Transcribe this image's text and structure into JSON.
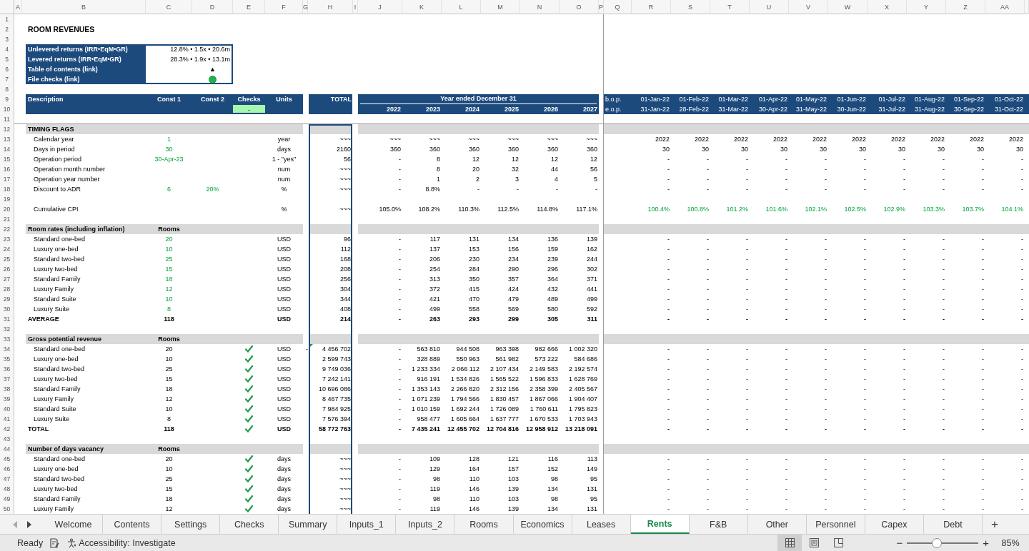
{
  "title": "ROOM REVENUES",
  "column_headers": [
    "A",
    "B",
    "C",
    "D",
    "E",
    "F",
    "G",
    "H",
    "I",
    "J",
    "K",
    "L",
    "M",
    "N",
    "O",
    "P",
    "Q",
    "R",
    "S",
    "T",
    "U",
    "V",
    "W",
    "X",
    "Y",
    "Z",
    "AA"
  ],
  "row_numbers": [
    "1",
    "2",
    "3",
    "4",
    "5",
    "6",
    "7",
    "8",
    "9",
    "10",
    "11",
    "12",
    "13",
    "14",
    "15",
    "16",
    "17",
    "18",
    "19",
    "20",
    "21",
    "22",
    "23",
    "24",
    "25",
    "26",
    "27",
    "28",
    "29",
    "30",
    "31",
    "32",
    "33",
    "34",
    "35",
    "36",
    "37",
    "38",
    "39",
    "40",
    "41",
    "42",
    "43",
    "44",
    "45",
    "46",
    "47",
    "48",
    "49",
    "50"
  ],
  "summary": [
    {
      "label": "Unlevered returns (IRR•EqM•GR)",
      "kind": "text",
      "value": "12.8% • 1.5x • 20.6m"
    },
    {
      "label": "Levered returns (IRR•EqM•GR)",
      "kind": "text",
      "value": "28.3% • 1.9x • 13.1m"
    },
    {
      "label": "Table of contents (link)",
      "kind": "link",
      "value": "▲"
    },
    {
      "label": "File checks (link)",
      "kind": "status",
      "ok": true
    }
  ],
  "header": {
    "description": "Description",
    "const1": "Const 1",
    "const2": "Const 2",
    "checks": "Checks",
    "checks_value": "-",
    "units": "Units",
    "total": "TOTAL",
    "annual_title": "Year ended December 31",
    "years": [
      "2022",
      "2023",
      "2024",
      "2025",
      "2026",
      "2027"
    ],
    "bop_label": "b.o.p.",
    "eop_label": "e.o.p.",
    "bop": [
      "01-Jan-22",
      "01-Feb-22",
      "01-Mar-22",
      "01-Apr-22",
      "01-May-22",
      "01-Jun-22",
      "01-Jul-22",
      "01-Aug-22",
      "01-Sep-22",
      "01-Oct-22"
    ],
    "eop": [
      "31-Jan-22",
      "28-Feb-22",
      "31-Mar-22",
      "30-Apr-22",
      "31-May-22",
      "30-Jun-22",
      "31-Jul-22",
      "31-Aug-22",
      "30-Sep-22",
      "31-Oct-22"
    ]
  },
  "rows": [
    {
      "kind": "section",
      "label": "TIMING FLAGS"
    },
    {
      "kind": "item",
      "label": "Calendar year",
      "const1": "1",
      "input": true,
      "units": "year",
      "total": "~~~",
      "annual": [
        "~~~",
        "~~~",
        "~~~",
        "~~~",
        "~~~",
        "~~~"
      ],
      "monthly": [
        "2022",
        "2022",
        "2022",
        "2022",
        "2022",
        "2022",
        "2022",
        "2022",
        "2022",
        "2022"
      ]
    },
    {
      "kind": "item",
      "label": "Days in period",
      "const1": "30",
      "input": true,
      "units": "days",
      "total": "2160",
      "annual": [
        "360",
        "360",
        "360",
        "360",
        "360",
        "360"
      ],
      "monthly": [
        "30",
        "30",
        "30",
        "30",
        "30",
        "30",
        "30",
        "30",
        "30",
        "30"
      ]
    },
    {
      "kind": "item",
      "label": "Operation period",
      "const1": "30-Apr-23",
      "input": true,
      "units": "1 - \"yes\"",
      "total": "56",
      "annual": [
        "-",
        "8",
        "12",
        "12",
        "12",
        "12"
      ],
      "monthly": [
        "-",
        "-",
        "-",
        "-",
        "-",
        "-",
        "-",
        "-",
        "-",
        "-"
      ]
    },
    {
      "kind": "item",
      "label": "Operation month number",
      "units": "num",
      "total": "~~~",
      "annual": [
        "-",
        "8",
        "20",
        "32",
        "44",
        "56"
      ],
      "monthly": [
        "-",
        "-",
        "-",
        "-",
        "-",
        "-",
        "-",
        "-",
        "-",
        "-"
      ]
    },
    {
      "kind": "item",
      "label": "Operation year number",
      "units": "num",
      "total": "~~~",
      "annual": [
        "-",
        "1",
        "2",
        "3",
        "4",
        "5"
      ],
      "monthly": [
        "-",
        "-",
        "-",
        "-",
        "-",
        "-",
        "-",
        "-",
        "-",
        "-"
      ]
    },
    {
      "kind": "item",
      "label": "Discount to ADR",
      "const1": "6",
      "const2": "20%",
      "input": true,
      "units": "%",
      "total": "~~~",
      "annual": [
        "-",
        "8.8%",
        "-",
        "-",
        "-",
        "-"
      ],
      "monthly": [
        "-",
        "-",
        "-",
        "-",
        "-",
        "-",
        "-",
        "-",
        "-",
        "-"
      ]
    },
    {
      "kind": "blank"
    },
    {
      "kind": "item",
      "label": "Cumulative CPI",
      "units": "%",
      "total": "~~~",
      "annual": [
        "105.0%",
        "108.2%",
        "110.3%",
        "112.5%",
        "114.8%",
        "117.1%"
      ],
      "monthly_input": true,
      "monthly": [
        "100.4%",
        "100.8%",
        "101.2%",
        "101.6%",
        "102.1%",
        "102.5%",
        "102.9%",
        "103.3%",
        "103.7%",
        "104.1%"
      ]
    },
    {
      "kind": "blank"
    },
    {
      "kind": "section",
      "label": "Room rates (including inflation)",
      "const1": "Rooms"
    },
    {
      "kind": "item",
      "label": "Standard one-bed",
      "const1": "20",
      "input": true,
      "units": "USD",
      "total": "96",
      "annual": [
        "-",
        "117",
        "131",
        "134",
        "136",
        "139"
      ],
      "monthly": [
        "-",
        "-",
        "-",
        "-",
        "-",
        "-",
        "-",
        "-",
        "-",
        "-"
      ]
    },
    {
      "kind": "item",
      "label": "Luxury one-bed",
      "const1": "10",
      "input": true,
      "units": "USD",
      "total": "112",
      "annual": [
        "-",
        "137",
        "153",
        "156",
        "159",
        "162"
      ],
      "monthly": [
        "-",
        "-",
        "-",
        "-",
        "-",
        "-",
        "-",
        "-",
        "-",
        "-"
      ]
    },
    {
      "kind": "item",
      "label": "Standard two-bed",
      "const1": "25",
      "input": true,
      "units": "USD",
      "total": "168",
      "annual": [
        "-",
        "206",
        "230",
        "234",
        "239",
        "244"
      ],
      "monthly": [
        "-",
        "-",
        "-",
        "-",
        "-",
        "-",
        "-",
        "-",
        "-",
        "-"
      ]
    },
    {
      "kind": "item",
      "label": "Luxury two-bed",
      "const1": "15",
      "input": true,
      "units": "USD",
      "total": "208",
      "annual": [
        "-",
        "254",
        "284",
        "290",
        "296",
        "302"
      ],
      "monthly": [
        "-",
        "-",
        "-",
        "-",
        "-",
        "-",
        "-",
        "-",
        "-",
        "-"
      ]
    },
    {
      "kind": "item",
      "label": "Standard Family",
      "const1": "18",
      "input": true,
      "units": "USD",
      "total": "256",
      "annual": [
        "-",
        "313",
        "350",
        "357",
        "364",
        "371"
      ],
      "monthly": [
        "-",
        "-",
        "-",
        "-",
        "-",
        "-",
        "-",
        "-",
        "-",
        "-"
      ]
    },
    {
      "kind": "item",
      "label": "Luxury Family",
      "const1": "12",
      "input": true,
      "units": "USD",
      "total": "304",
      "annual": [
        "-",
        "372",
        "415",
        "424",
        "432",
        "441"
      ],
      "monthly": [
        "-",
        "-",
        "-",
        "-",
        "-",
        "-",
        "-",
        "-",
        "-",
        "-"
      ]
    },
    {
      "kind": "item",
      "label": "Standard Suite",
      "const1": "10",
      "input": true,
      "units": "USD",
      "total": "344",
      "annual": [
        "-",
        "421",
        "470",
        "479",
        "489",
        "499"
      ],
      "monthly": [
        "-",
        "-",
        "-",
        "-",
        "-",
        "-",
        "-",
        "-",
        "-",
        "-"
      ]
    },
    {
      "kind": "item",
      "label": "Luxury Suite",
      "const1": "8",
      "input": true,
      "units": "USD",
      "total": "408",
      "annual": [
        "-",
        "499",
        "558",
        "569",
        "580",
        "592"
      ],
      "monthly": [
        "-",
        "-",
        "-",
        "-",
        "-",
        "-",
        "-",
        "-",
        "-",
        "-"
      ]
    },
    {
      "kind": "total",
      "label": "AVERAGE",
      "const1": "118",
      "units": "USD",
      "total": "214",
      "annual": [
        "-",
        "263",
        "293",
        "299",
        "305",
        "311"
      ],
      "monthly": [
        "-",
        "-",
        "-",
        "-",
        "-",
        "-",
        "-",
        "-",
        "-",
        "-"
      ]
    },
    {
      "kind": "blank"
    },
    {
      "kind": "section",
      "label": "Gross potential revenue",
      "const1": "Rooms"
    },
    {
      "kind": "item",
      "label": "Standard one-bed",
      "const1": "20",
      "checked": true,
      "units": "USD",
      "col_g": "-",
      "flagged": true,
      "total": "4 456 702",
      "annual": [
        "-",
        "563 810",
        "944 508",
        "963 398",
        "982 666",
        "1 002 320"
      ],
      "monthly": [
        "-",
        "-",
        "-",
        "-",
        "-",
        "-",
        "-",
        "-",
        "-",
        "-"
      ]
    },
    {
      "kind": "item",
      "label": "Luxury one-bed",
      "const1": "10",
      "checked": true,
      "units": "USD",
      "total": "2 599 743",
      "annual": [
        "-",
        "328 889",
        "550 963",
        "561 982",
        "573 222",
        "584 686"
      ],
      "monthly": [
        "-",
        "-",
        "-",
        "-",
        "-",
        "-",
        "-",
        "-",
        "-",
        "-"
      ]
    },
    {
      "kind": "item",
      "label": "Standard two-bed",
      "const1": "25",
      "checked": true,
      "units": "USD",
      "total": "9 749 036",
      "annual": [
        "-",
        "1 233 334",
        "2 066 112",
        "2 107 434",
        "2 149 583",
        "2 192 574"
      ],
      "monthly": [
        "-",
        "-",
        "-",
        "-",
        "-",
        "-",
        "-",
        "-",
        "-",
        "-"
      ]
    },
    {
      "kind": "item",
      "label": "Luxury two-bed",
      "const1": "15",
      "checked": true,
      "units": "USD",
      "total": "7 242 141",
      "annual": [
        "-",
        "916 191",
        "1 534 826",
        "1 565 522",
        "1 596 833",
        "1 628 769"
      ],
      "monthly": [
        "-",
        "-",
        "-",
        "-",
        "-",
        "-",
        "-",
        "-",
        "-",
        "-"
      ]
    },
    {
      "kind": "item",
      "label": "Standard Family",
      "const1": "18",
      "checked": true,
      "units": "USD",
      "total": "10 696 086",
      "annual": [
        "-",
        "1 353 143",
        "2 266 820",
        "2 312 156",
        "2 358 399",
        "2 405 567"
      ],
      "monthly": [
        "-",
        "-",
        "-",
        "-",
        "-",
        "-",
        "-",
        "-",
        "-",
        "-"
      ]
    },
    {
      "kind": "item",
      "label": "Luxury Family",
      "const1": "12",
      "checked": true,
      "units": "USD",
      "total": "8 467 735",
      "annual": [
        "-",
        "1 071 239",
        "1 794 566",
        "1 830 457",
        "1 867 066",
        "1 904 407"
      ],
      "monthly": [
        "-",
        "-",
        "-",
        "-",
        "-",
        "-",
        "-",
        "-",
        "-",
        "-"
      ]
    },
    {
      "kind": "item",
      "label": "Standard Suite",
      "const1": "10",
      "checked": true,
      "units": "USD",
      "total": "7 984 925",
      "annual": [
        "-",
        "1 010 159",
        "1 692 244",
        "1 726 089",
        "1 760 611",
        "1 795 823"
      ],
      "monthly": [
        "-",
        "-",
        "-",
        "-",
        "-",
        "-",
        "-",
        "-",
        "-",
        "-"
      ]
    },
    {
      "kind": "item",
      "label": "Luxury Suite",
      "const1": "8",
      "checked": true,
      "units": "USD",
      "total": "7 576 394",
      "annual": [
        "-",
        "958 477",
        "1 605 664",
        "1 637 777",
        "1 670 533",
        "1 703 943"
      ],
      "monthly": [
        "-",
        "-",
        "-",
        "-",
        "-",
        "-",
        "-",
        "-",
        "-",
        "-"
      ]
    },
    {
      "kind": "total",
      "label": "TOTAL",
      "const1": "118",
      "checked": true,
      "units": "USD",
      "total": "58 772 763",
      "annual": [
        "-",
        "7 435 241",
        "12 455 702",
        "12 704 816",
        "12 958 912",
        "13 218 091"
      ],
      "monthly": [
        "-",
        "-",
        "-",
        "-",
        "-",
        "-",
        "-",
        "-",
        "-",
        "-"
      ]
    },
    {
      "kind": "blank"
    },
    {
      "kind": "section",
      "label": "Number of days vacancy",
      "const1": "Rooms"
    },
    {
      "kind": "item",
      "label": "Standard one-bed",
      "const1": "20",
      "checked": true,
      "units": "days",
      "total": "~~~",
      "annual": [
        "-",
        "109",
        "128",
        "121",
        "116",
        "113"
      ],
      "monthly": [
        "-",
        "-",
        "-",
        "-",
        "-",
        "-",
        "-",
        "-",
        "-",
        "-"
      ]
    },
    {
      "kind": "item",
      "label": "Luxury one-bed",
      "const1": "10",
      "checked": true,
      "units": "days",
      "total": "~~~",
      "annual": [
        "-",
        "129",
        "164",
        "157",
        "152",
        "149"
      ],
      "monthly": [
        "-",
        "-",
        "-",
        "-",
        "-",
        "-",
        "-",
        "-",
        "-",
        "-"
      ]
    },
    {
      "kind": "item",
      "label": "Standard two-bed",
      "const1": "25",
      "checked": true,
      "units": "days",
      "total": "~~~",
      "annual": [
        "-",
        "98",
        "110",
        "103",
        "98",
        "95"
      ],
      "monthly": [
        "-",
        "-",
        "-",
        "-",
        "-",
        "-",
        "-",
        "-",
        "-",
        "-"
      ]
    },
    {
      "kind": "item",
      "label": "Luxury two-bed",
      "const1": "15",
      "checked": true,
      "units": "days",
      "total": "~~~",
      "annual": [
        "-",
        "119",
        "146",
        "139",
        "134",
        "131"
      ],
      "monthly": [
        "-",
        "-",
        "-",
        "-",
        "-",
        "-",
        "-",
        "-",
        "-",
        "-"
      ]
    },
    {
      "kind": "item",
      "label": "Standard Family",
      "const1": "18",
      "checked": true,
      "units": "days",
      "total": "~~~",
      "annual": [
        "-",
        "98",
        "110",
        "103",
        "98",
        "95"
      ],
      "monthly": [
        "-",
        "-",
        "-",
        "-",
        "-",
        "-",
        "-",
        "-",
        "-",
        "-"
      ]
    },
    {
      "kind": "item",
      "label": "Luxury Family",
      "const1": "12",
      "checked": true,
      "units": "days",
      "total": "~~~",
      "annual": [
        "-",
        "119",
        "146",
        "139",
        "134",
        "131"
      ],
      "monthly": [
        "-",
        "-",
        "-",
        "-",
        "-",
        "-",
        "-",
        "-",
        "-",
        "-"
      ]
    }
  ],
  "tabs": [
    {
      "label": "Welcome",
      "selected": false
    },
    {
      "label": "Contents",
      "selected": false
    },
    {
      "label": "Settings",
      "selected": false
    },
    {
      "label": "Checks",
      "selected": false
    },
    {
      "label": "Summary",
      "selected": false
    },
    {
      "label": "Inputs_1",
      "selected": false
    },
    {
      "label": "Inputs_2",
      "selected": false
    },
    {
      "label": "Rooms",
      "selected": false
    },
    {
      "label": "Economics",
      "selected": false
    },
    {
      "label": "Leases",
      "selected": false
    },
    {
      "label": "Rents",
      "selected": true
    },
    {
      "label": "F&B",
      "selected": false
    },
    {
      "label": "Other",
      "selected": false
    },
    {
      "label": "Personnel",
      "selected": false
    },
    {
      "label": "Capex",
      "selected": false
    },
    {
      "label": "Debt",
      "selected": false
    }
  ],
  "add_sheet": "+",
  "status": {
    "text": "Ready",
    "accessibility": "Accessibility: Investigate",
    "views": [
      {
        "kind": "normal",
        "selected": true
      },
      {
        "kind": "page_layout",
        "selected": false
      },
      {
        "kind": "page_break",
        "selected": false
      }
    ],
    "zoom_out": "−",
    "zoom_in": "+",
    "zoom": {
      "level": 0.42,
      "reading": "85%"
    }
  }
}
